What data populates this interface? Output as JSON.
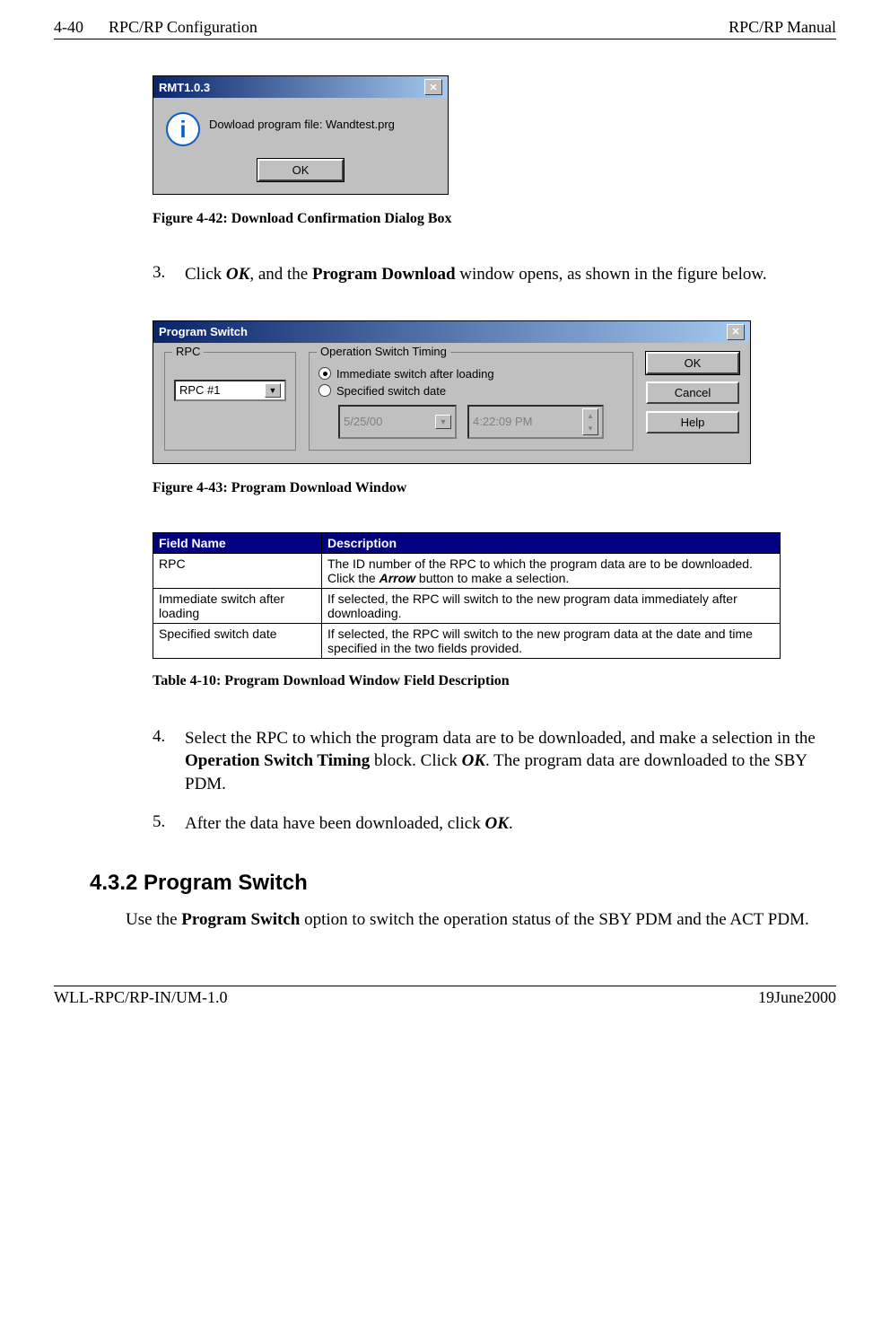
{
  "header": {
    "page_left": "4-40",
    "title_left": "RPC/RP Configuration",
    "title_right": "RPC/RP Manual"
  },
  "dialog_rmt": {
    "title": "RMT1.0.3",
    "icon_label": "i",
    "message": "Dowload program file: Wandtest.prg",
    "ok": "OK"
  },
  "fig42_caption": "Figure 4-42: Download Confirmation Dialog Box",
  "step3_pre": "Click ",
  "step3_ok": "OK",
  "step3_mid": ", and the ",
  "step3_pd": "Program Download",
  "step3_post": " window opens, as shown in the figure below.",
  "dialog_ps": {
    "title": "Program Switch",
    "rpc_label": "RPC",
    "rpc_value": "RPC #1",
    "opt_label": "Operation Switch Timing",
    "radio_immediate": "Immediate switch after loading",
    "radio_specified": "Specified switch date",
    "date_value": "5/25/00",
    "time_value": "4:22:09 PM",
    "btn_ok": "OK",
    "btn_cancel": "Cancel",
    "btn_help": "Help"
  },
  "fig43_caption": "Figure 4-43: Program Download Window",
  "table": {
    "head_field": "Field Name",
    "head_desc": "Description",
    "rows": [
      {
        "field": "RPC",
        "desc_pre": "The ID number of the RPC to which the program data are to be downloaded.  Click the ",
        "desc_bold": "Arrow",
        "desc_post": " button to make a selection."
      },
      {
        "field": "Immediate  switch after loading",
        "desc_pre": "If selected, the RPC will switch to the new program data immediately after downloading.",
        "desc_bold": "",
        "desc_post": ""
      },
      {
        "field": "Specified switch date",
        "desc_pre": "If selected, the RPC will switch to the new program data at the date and time specified in the two fields provided.",
        "desc_bold": "",
        "desc_post": ""
      }
    ]
  },
  "table_caption": "Table 4-10: Program Download Window Field Description",
  "step4_pre": "Select the RPC to which the program data are to be downloaded, and make a selection in the ",
  "step4_b1": "Operation Switch Timing",
  "step4_mid": " block.  Click ",
  "step4_ok": "OK",
  "step4_post": ".  The program data are downloaded to the SBY PDM.",
  "step5_pre": "After the data have been downloaded, click ",
  "step5_ok": "OK",
  "step5_post": ".",
  "section_title": "4.3.2 Program Switch",
  "section_text_pre": "Use the ",
  "section_text_b": "Program Switch",
  "section_text_post": " option to switch the operation status of the SBY PDM and the ACT PDM.",
  "footer": {
    "left": "WLL-RPC/RP-IN/UM-1.0",
    "right": "19June2000"
  }
}
